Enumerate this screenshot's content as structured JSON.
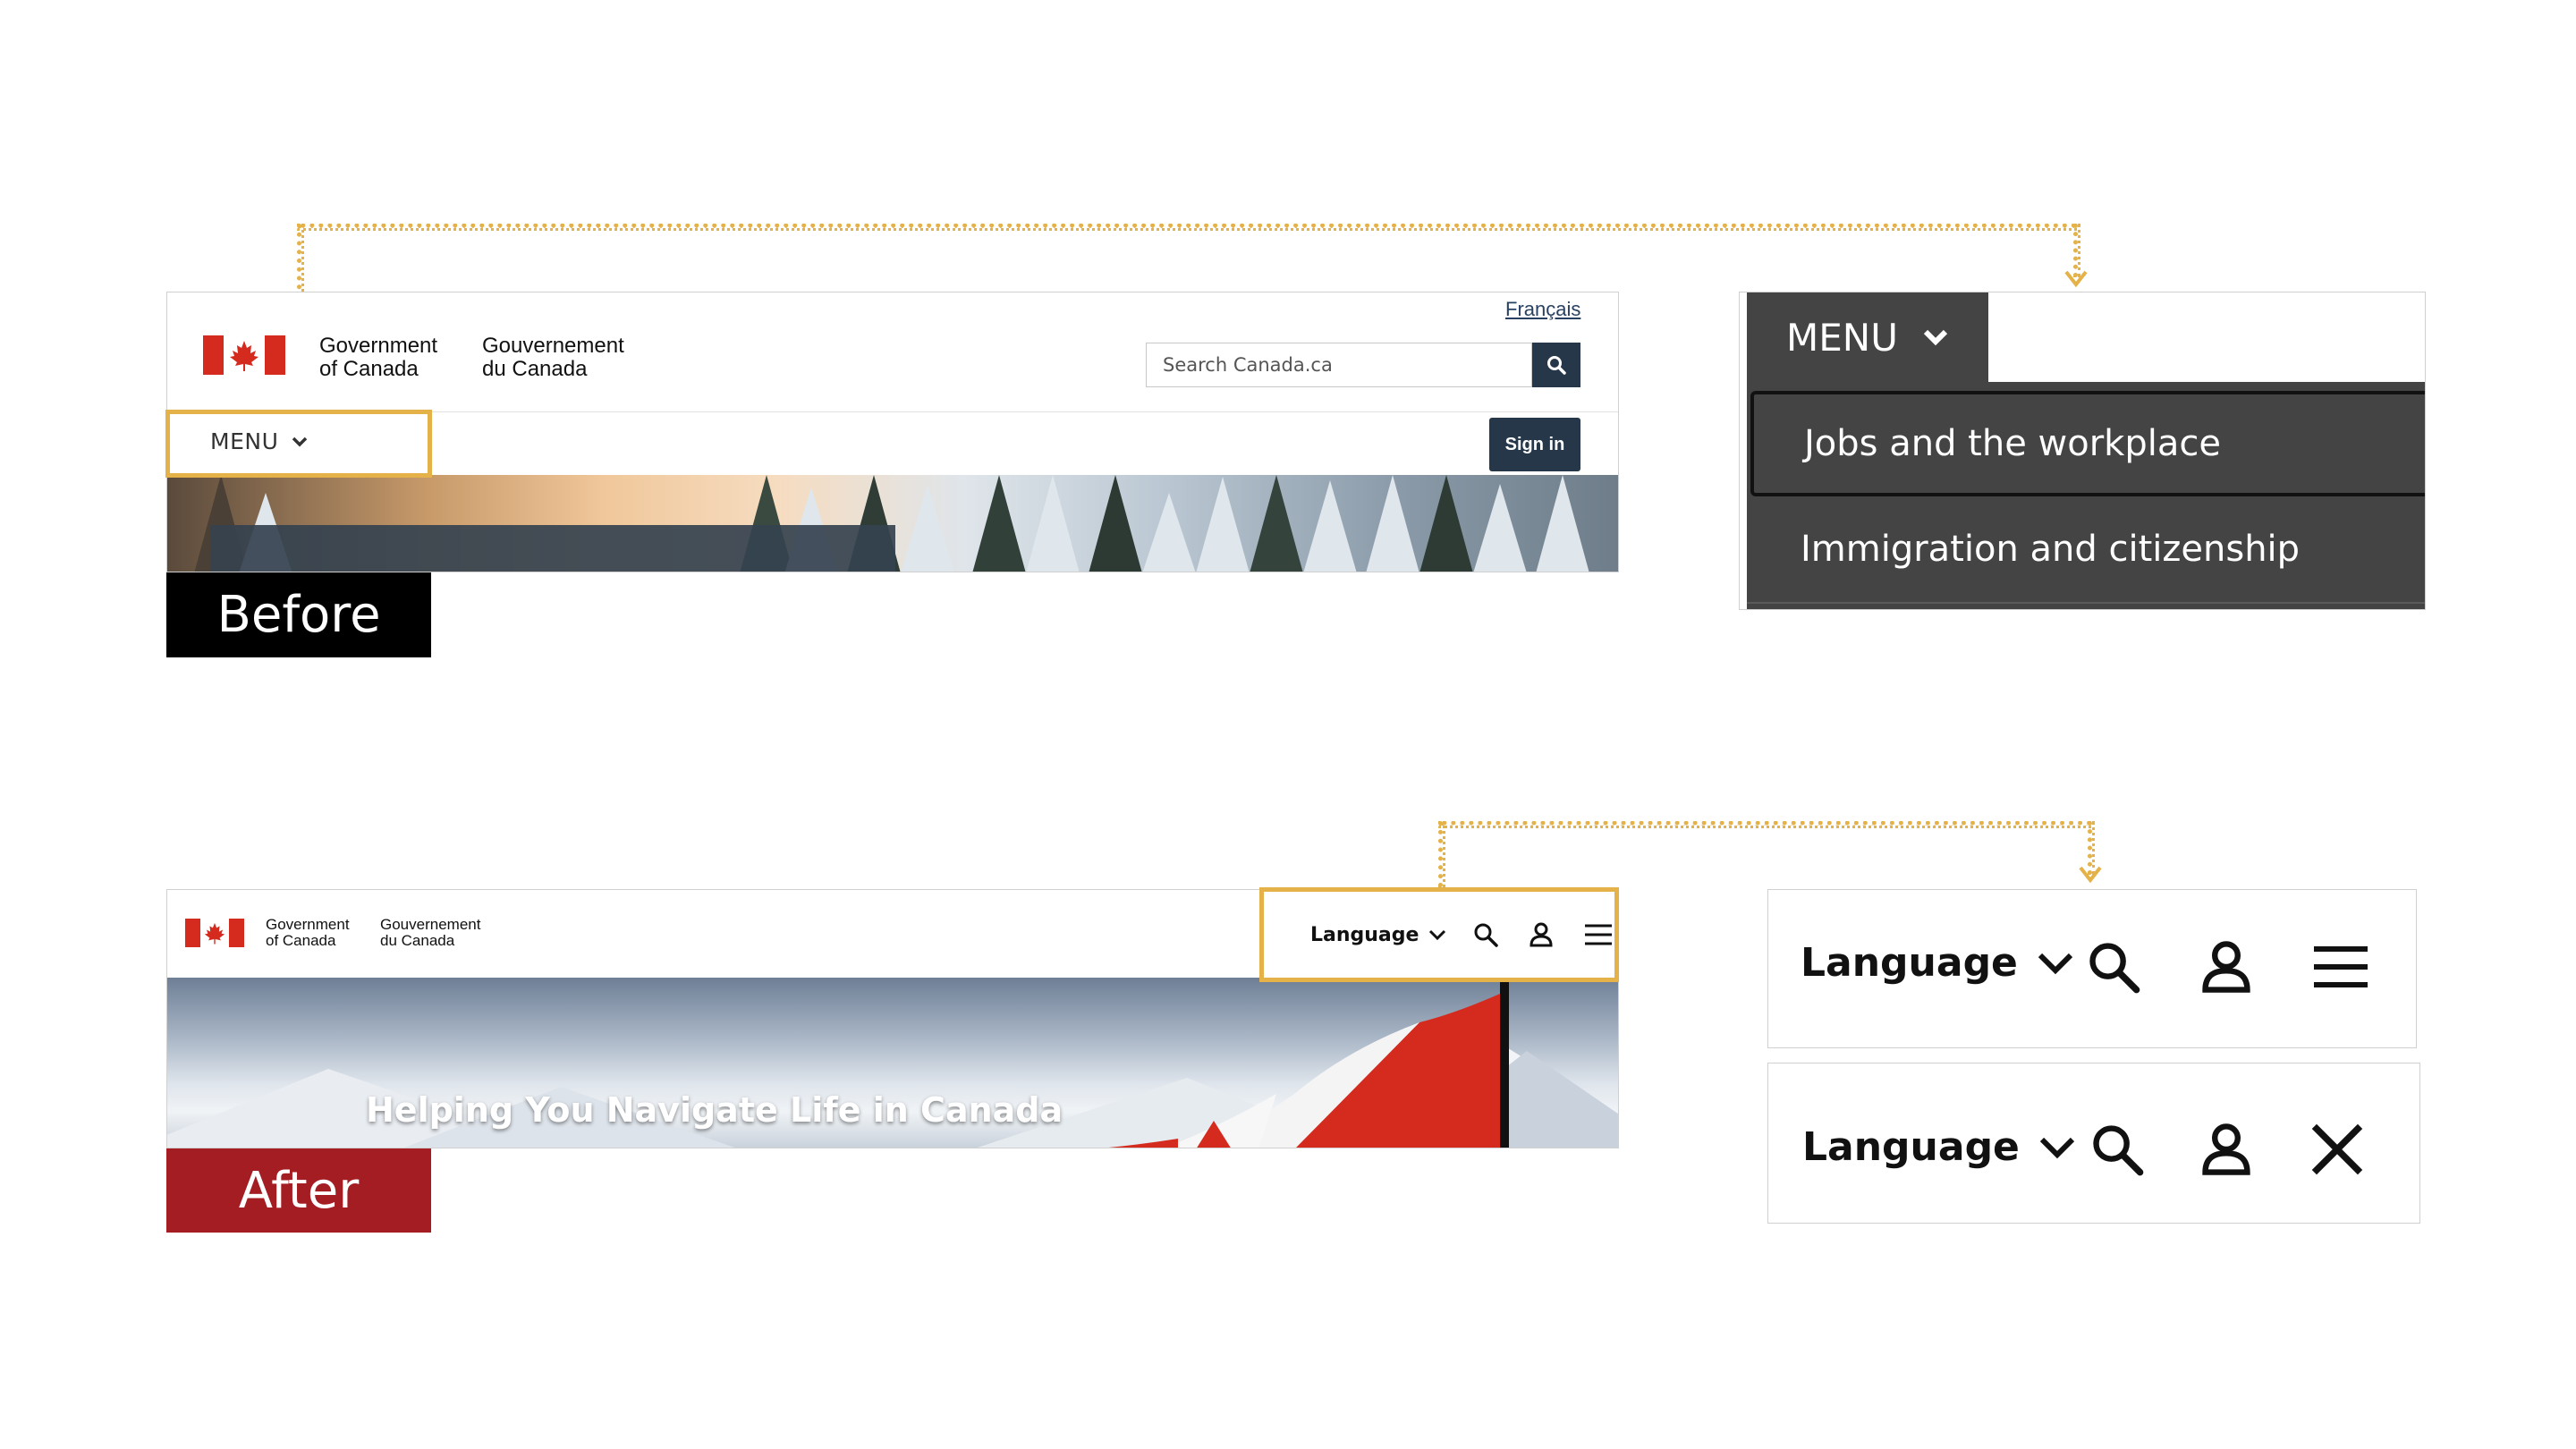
{
  "colors": {
    "accent": "#e5b249",
    "canada_red": "#d52b1e",
    "gc_navy": "#26374a",
    "before_tag": "#000000",
    "after_tag": "#a31d23",
    "menu_dark": "#444444"
  },
  "before": {
    "wordmark_en_line1": "Government",
    "wordmark_en_line2": "of Canada",
    "wordmark_fr_line1": "Gouvernement",
    "wordmark_fr_line2": "du Canada",
    "language_link": "Français",
    "search_placeholder": "Search Canada.ca",
    "search_icon": "search-icon",
    "menu_label": "MENU",
    "menu_icon": "chevron-down-icon",
    "signin_label": "Sign in",
    "tag_label": "Before"
  },
  "menu_zoom": {
    "menu_label": "MENU",
    "items": [
      {
        "label": "Jobs and the workplace",
        "active": true
      },
      {
        "label": "Immigration and citizenship",
        "active": false
      }
    ]
  },
  "after": {
    "wordmark_en_line1": "Government",
    "wordmark_en_line2": "of Canada",
    "wordmark_fr_line1": "Gouvernement",
    "wordmark_fr_line2": "du Canada",
    "language_label": "Language",
    "hero_title": "Helping You Navigate Life in Canada",
    "tag_label": "After",
    "icons": [
      "chevron-down-icon",
      "search-icon",
      "user-icon",
      "menu-icon"
    ]
  },
  "zoom_rows": [
    {
      "language_label": "Language",
      "last_icon": "menu-icon"
    },
    {
      "language_label": "Language",
      "last_icon": "close-icon"
    }
  ]
}
